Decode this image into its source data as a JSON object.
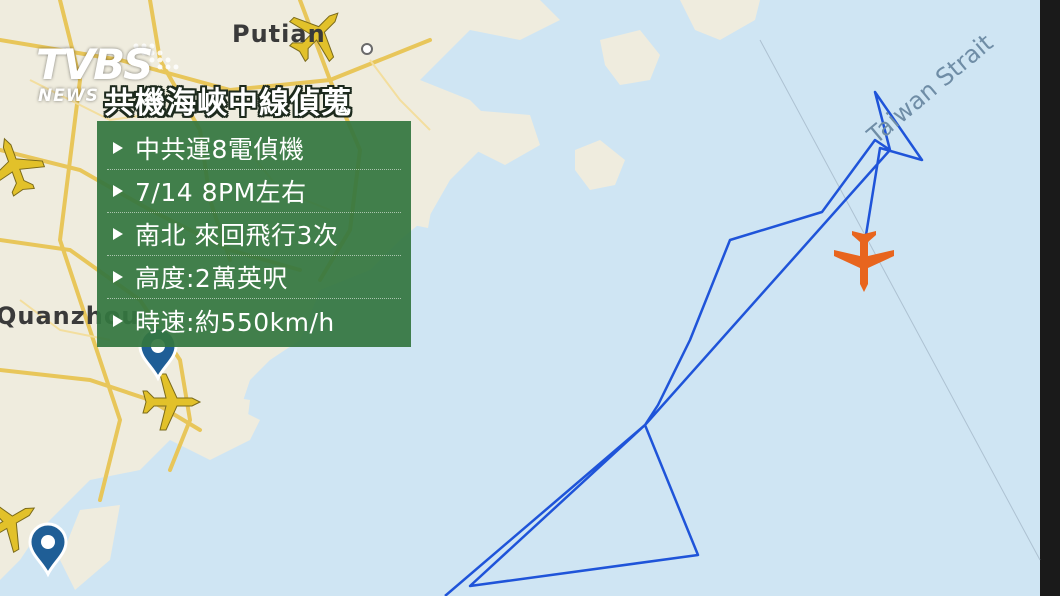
{
  "map": {
    "city_labels": [
      "Putian",
      "Quanzhou"
    ],
    "strait_label": "Taiwan Strait",
    "colors": {
      "sea": "#cfe5f3",
      "land": "#efecde",
      "road": "#e8c65a",
      "track": "#1f54d9",
      "target_aircraft": "#e8651e",
      "other_aircraft": "#e2c12a",
      "pin": "#1f5e96"
    }
  },
  "logo": {
    "brand": "TVBS",
    "sub": "NEWS"
  },
  "headline": "共機海峽中線偵蒐",
  "info": {
    "items": [
      "中共運8電偵機",
      "7/14 8PM左右",
      "南北 來回飛行3次",
      "高度:2萬英呎",
      "時速:約550km/h"
    ]
  },
  "icons": [
    "airplane-icon",
    "location-pin-icon",
    "triangle-bullet-icon"
  ]
}
